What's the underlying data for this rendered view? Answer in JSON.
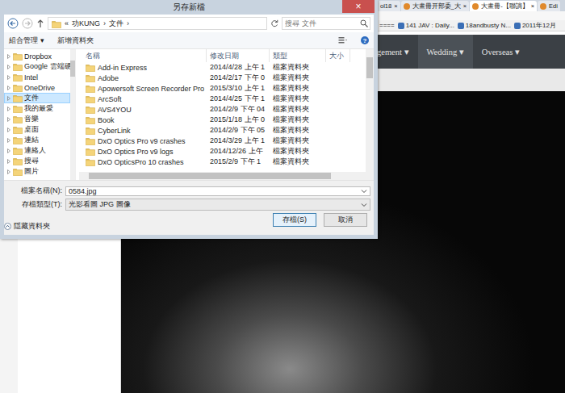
{
  "browser": {
    "tabs": [
      {
        "label": "ol18",
        "close": "×",
        "selected": false
      },
      {
        "label": "大畫冊开部委_大",
        "close": "×",
        "selected": false
      },
      {
        "label": "大畫冊-【聯謫】",
        "close": "×",
        "selected": true
      },
      {
        "label": "Edi",
        "selected": false
      }
    ],
    "bookmarks": [
      "====",
      "141 JAV : Daily...",
      "18andbusty N...",
      "2011年12月"
    ],
    "nav": [
      {
        "label": "gement ▾",
        "selected": false
      },
      {
        "label": "Wedding ▾",
        "selected": true
      },
      {
        "label": "Overseas ▾",
        "selected": false
      }
    ]
  },
  "dialog": {
    "title": "另存新檔",
    "close": "×",
    "breadcrumb": {
      "prefix": "«",
      "parts": [
        "功KUNG",
        "文件"
      ],
      "sep": "›"
    },
    "search": {
      "placeholder": "搜尋 文件"
    },
    "toolbar": [
      "組合管理 ▾",
      "新增資料夾"
    ],
    "help": "?",
    "tree": [
      {
        "label": "Dropbox",
        "selected": false
      },
      {
        "label": "Google 雲端硬碟",
        "selected": false
      },
      {
        "label": "Intel",
        "selected": false
      },
      {
        "label": "OneDrive",
        "selected": false
      },
      {
        "label": "文件",
        "selected": true
      },
      {
        "label": "我的最愛",
        "selected": false
      },
      {
        "label": "音樂",
        "selected": false
      },
      {
        "label": "桌面",
        "selected": false
      },
      {
        "label": "連結",
        "selected": false
      },
      {
        "label": "連絡人",
        "selected": false
      },
      {
        "label": "搜尋",
        "selected": false
      },
      {
        "label": "圖片",
        "selected": false
      }
    ],
    "columns": [
      "名稱",
      "修改日期",
      "類型",
      "大小"
    ],
    "rows": [
      {
        "name": "Add-in Express",
        "date": "2014/4/28 上午 1",
        "type": "檔案資料夾"
      },
      {
        "name": "Adobe",
        "date": "2014/2/17 下午 0",
        "type": "檔案資料夾"
      },
      {
        "name": "Apowersoft Screen Recorder Pro",
        "date": "2015/3/10 上午 1",
        "type": "檔案資料夾"
      },
      {
        "name": "ArcSoft",
        "date": "2014/4/25 下午 1",
        "type": "檔案資料夾"
      },
      {
        "name": "AVS4YOU",
        "date": "2014/2/9 下午 04",
        "type": "檔案資料夾"
      },
      {
        "name": "Book",
        "date": "2015/1/18 上午 0",
        "type": "檔案資料夾"
      },
      {
        "name": "CyberLink",
        "date": "2014/2/9 下午 05",
        "type": "檔案資料夾"
      },
      {
        "name": "DxO Optics Pro v9 crashes",
        "date": "2014/3/29 上午 1",
        "type": "檔案資料夾"
      },
      {
        "name": "DxO Optics Pro v9 logs",
        "date": "2014/12/26 上午",
        "type": "檔案資料夾"
      },
      {
        "name": "DxO OpticsPro 10 crashes",
        "date": "2015/2/9 下午 1",
        "type": "檔案資料夾"
      }
    ],
    "filename_label": "檔案名稱(N):",
    "filename": "0584.jpg",
    "filetype_label": "存檔類型(T):",
    "filetype": "光影看圖 JPG 圖像",
    "buttons": [
      "存檔(S)",
      "取消"
    ],
    "hide_folders": "隱藏資料夾"
  }
}
